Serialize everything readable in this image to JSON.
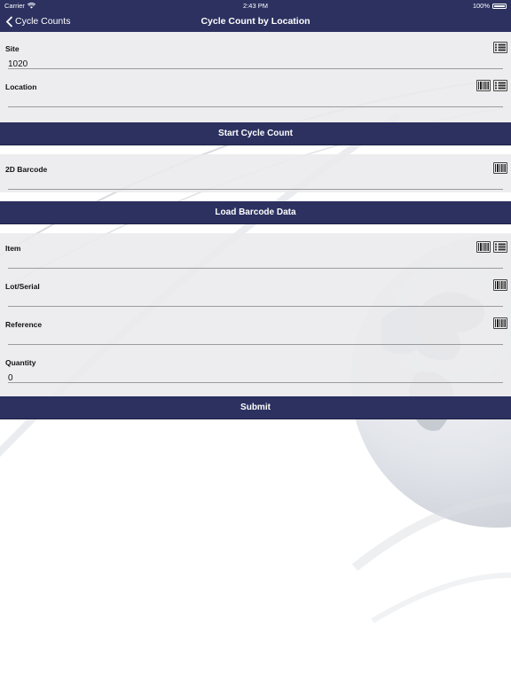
{
  "status_bar": {
    "carrier": "Carrier",
    "time": "2:43 PM",
    "battery": "100%"
  },
  "nav": {
    "back_label": "Cycle Counts",
    "title": "Cycle Count by Location"
  },
  "site": {
    "label": "Site",
    "value": "1020"
  },
  "location": {
    "label": "Location",
    "value": ""
  },
  "start_button": "Start Cycle Count",
  "barcode_2d": {
    "label": "2D Barcode",
    "value": ""
  },
  "load_button": "Load Barcode Data",
  "item": {
    "label": "Item",
    "value": ""
  },
  "lot_serial": {
    "label": "Lot/Serial",
    "value": ""
  },
  "reference": {
    "label": "Reference",
    "value": ""
  },
  "quantity": {
    "label": "Quantity",
    "value": "0"
  },
  "submit_button": "Submit",
  "colors": {
    "nav_bar": "#2c3160",
    "panel": "#ebebed",
    "button": "#2c3160"
  }
}
